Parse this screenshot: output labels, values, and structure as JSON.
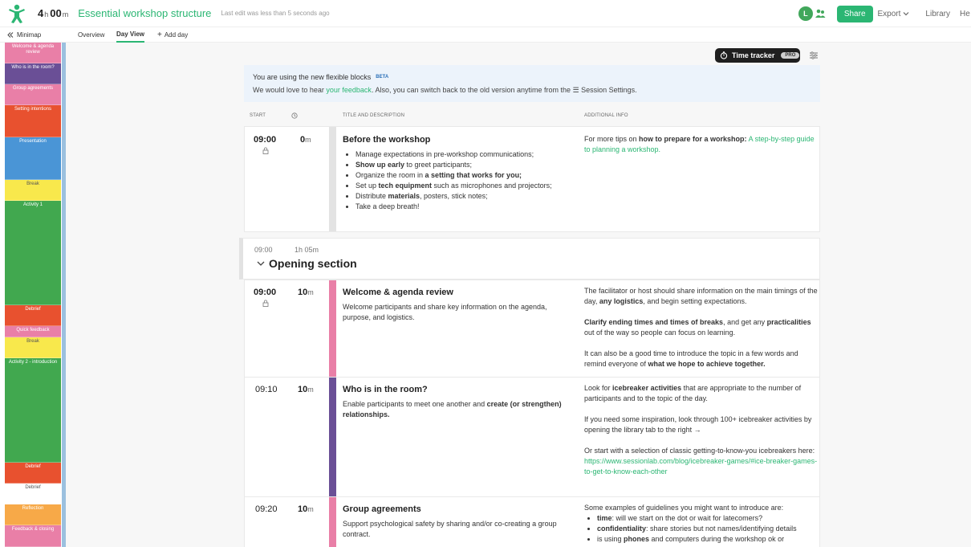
{
  "header": {
    "duration_hours": "4",
    "duration_h_unit": "h",
    "duration_minutes": "00",
    "duration_m_unit": "m",
    "title": "Essential workshop structure",
    "last_edit": "Last edit was less than 5 seconds ago",
    "avatar_letter": "L",
    "share_label": "Share",
    "export_label": "Export",
    "library_label": "Library",
    "help_label": "He"
  },
  "subnav": {
    "minimap_label": "Minimap",
    "tabs": [
      {
        "label": "Overview"
      },
      {
        "label": "Day View"
      },
      {
        "label": "Add day"
      }
    ]
  },
  "minimap": [
    {
      "label": "Welcome & agenda review",
      "color": "#e97fa7"
    },
    {
      "label": "Who is in the room?",
      "color": "#6a4f96"
    },
    {
      "label": "Group agreements",
      "color": "#e97fa7"
    },
    {
      "label": "Setting intentions",
      "color": "#e8512f"
    },
    {
      "label": "Presentation",
      "color": "#4a95d6"
    },
    {
      "label": "Break",
      "color": "#f8e84c"
    },
    {
      "label": "Activity 1",
      "color": "#41a84f"
    },
    {
      "label": "Debrief",
      "color": "#e8512f"
    },
    {
      "label": "Quick feedback",
      "color": "#e97fa7"
    },
    {
      "label": "Break",
      "color": "#f8e84c"
    },
    {
      "label": "Activity 2 - introduction",
      "color": "#41a84f"
    },
    {
      "label": "Debrief",
      "color": "#e8512f"
    },
    {
      "label": "Debrief",
      "color": "#ffffff"
    },
    {
      "label": "Reflection",
      "color": "#f7a948"
    },
    {
      "label": "Feedback & closing",
      "color": "#e97fa7"
    }
  ],
  "toolbar": {
    "time_tracker_label": "Time tracker",
    "pro_badge": "PRO"
  },
  "banner": {
    "line1": "You are using the new flexible blocks",
    "beta": "BETA",
    "line2_a": "We would love to hear ",
    "feedback_link": "your feedback",
    "line2_b": ". Also, you can switch back to the old version anytime from the ",
    "line2_c": " Session Settings."
  },
  "columns": {
    "start": "START",
    "title": "TITLE AND DESCRIPTION",
    "info": "ADDITIONAL INFO"
  },
  "blocks": {
    "before": {
      "start": "09:00",
      "duration": "0",
      "unit": "m",
      "title": "Before the workshop",
      "bullets": {
        "b1": "Manage expectations in pre-workshop communications;",
        "b2_bold": "Show up early",
        "b2_rest": " to greet participants;",
        "b3_a": "Organize the room in ",
        "b3_bold": "a setting that works for you;",
        "b4_a": "Set up ",
        "b4_bold": "tech equipment",
        "b4_rest": " such as microphones and projectors;",
        "b5_a": "Distribute ",
        "b5_bold": "materials",
        "b5_rest": ", posters, stick notes;",
        "b6": "Take a deep breath!"
      },
      "info_a": "For more tips on ",
      "info_bold": "how to prepare for a workshop:",
      "info_link": "A step-by-step guide to planning a workshop."
    },
    "section": {
      "start": "09:00",
      "duration": "1h 05m",
      "title": "Opening section"
    },
    "welcome": {
      "start": "09:00",
      "duration": "10",
      "unit": "m",
      "color": "#e97fa7",
      "title": "Welcome & agenda review",
      "desc": "Welcome participants and share key information on the agenda, purpose, and logistics.",
      "p1_a": "The facilitator or host should share information on the main timings of the day, ",
      "p1_bold": "any logistics",
      "p1_b": ", and begin setting expectations.",
      "p2_bold1": "Clarify ending times and times of breaks",
      "p2_a": ", and get any ",
      "p2_bold2": "practicalities",
      "p2_b": " out of the way so people can focus on learning.",
      "p3_a": "It can also be a good time to introduce the topic in a few words and remind everyone of ",
      "p3_bold": "what we hope to achieve together."
    },
    "who": {
      "start": "09:10",
      "duration": "10",
      "unit": "m",
      "color": "#6a4f96",
      "title": "Who is in the room?",
      "desc_a": "Enable participants to meet one another and ",
      "desc_bold": "create (or strengthen) relationships.",
      "p1_a": "Look for ",
      "p1_bold": "icebreaker activities",
      "p1_b": " that are appropriate to the number of participants and to the topic of the day.",
      "p2": "If you need some inspiration, look through 100+ icebreaker activities by opening the library tab to the right →",
      "p3_a": "Or start with a selection of classic getting-to-know-you icebreakers here: ",
      "p3_link": "https://www.sessionlab.com/blog/icebreaker-games/#ice-breaker-games-to-get-to-know-each-other"
    },
    "group": {
      "start": "09:20",
      "duration": "10",
      "unit": "m",
      "color": "#e97fa7",
      "title": "Group agreements",
      "desc": "Support psychological safety by sharing and/or co-creating a group contract.",
      "intro": "Some examples of guidelines you might want to introduce are:",
      "li1_bold": "time",
      "li1_rest": ": will we start on the dot or wait for latecomers?",
      "li2_bold": "confidentiality",
      "li2_rest": ": share stories but not names/identifying details",
      "li3_a": "is using ",
      "li3_bold": "phones",
      "li3_rest": " and computers during the workshop ok or"
    }
  }
}
